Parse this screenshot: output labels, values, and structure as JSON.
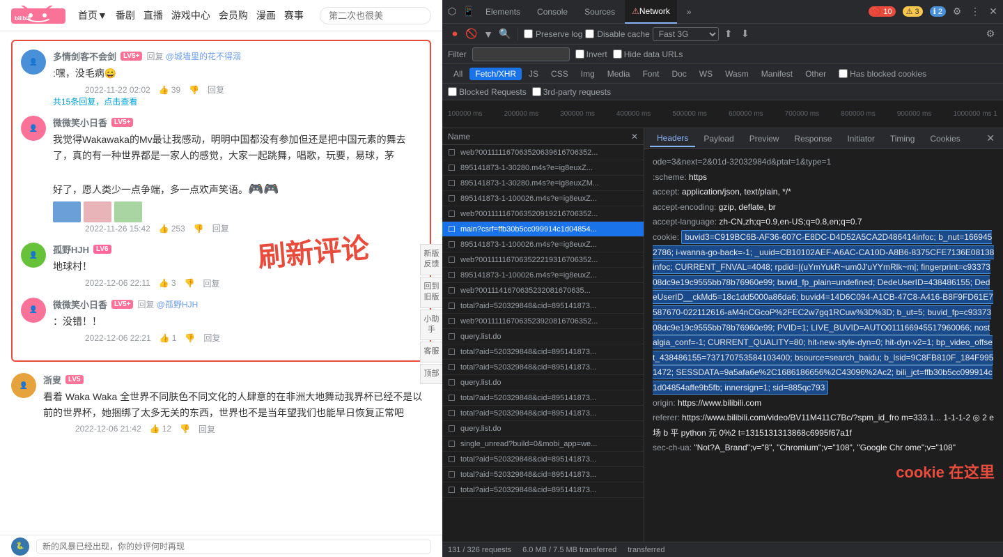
{
  "bilibili": {
    "logo_text": "哔哩哔哩",
    "nav_items": [
      "首页▼",
      "番剧",
      "直播",
      "游戏中心",
      "会员购",
      "漫画",
      "赛事"
    ],
    "search_placeholder": "第二次也很美",
    "comments": [
      {
        "id": 1,
        "username": "多情剑客不会剑",
        "level": "LV5+",
        "level_class": "lv5",
        "reply_to": "@城墙里的花不得溺",
        "text": ":嘿，没毛病",
        "emoji": "😄",
        "date": "2022-11-22 02:02",
        "likes": "39",
        "sub_comments_count": "共15条回复，点击查看"
      },
      {
        "id": 2,
        "username": "微微笑小日香",
        "level": "LV5+",
        "level_class": "lv5",
        "text": "我觉得Wakawaka的Mv最让我感动，明明中国都没有参加但还是把中国元素的舞去了，真的有一种世界都是一家人的感觉，大家一起跳舞，唱歌，玩要，易球，\n\n好了，愿人类少一点争端，多一点欢声笑语。",
        "date": "2022-11-26 15:42",
        "likes": "253",
        "has_images": true
      },
      {
        "id": 3,
        "username": "孤野HJH",
        "level": "LV6",
        "level_class": "lv6",
        "text": "地球村！",
        "date": "2022-12-06 22:11",
        "likes": "3"
      },
      {
        "id": 4,
        "username": "微微笑小日香",
        "level": "LV5+",
        "level_class": "lv5",
        "reply_to": "@孤野HJH",
        "text": "：没错！！",
        "date": "2022-12-06 22:21",
        "likes": "1"
      }
    ],
    "long_comment": {
      "username": "浙叟",
      "level": "LV5",
      "level_class": "lv5",
      "text": "看着 Waka Waka 全世界不同肤色不同文化的人肆意的在非洲大地舞动我界杯已经不是以前的世界杯，她捆绑了太多无关的东西，世界也不是当年望我们也能早日恢复正常吧",
      "date": "2022-12-06 21:42",
      "likes": "12"
    },
    "refresh_label": "刷新评论",
    "side_buttons": [
      "新版\n反馈",
      "回到\n旧版",
      "小助\n手",
      "客服"
    ],
    "bottom_placeholder": "新的风暴已经出现，你的妙评何时再现",
    "top_btn": "顶部"
  },
  "devtools": {
    "tabs": [
      "Elements",
      "Console",
      "Sources",
      "Network",
      "»"
    ],
    "active_tab": "Network",
    "error_count": "10",
    "warning_count": "3",
    "info_count": "2",
    "toolbar": {
      "record_tooltip": "Record network log",
      "clear_tooltip": "Clear",
      "filter_tooltip": "Filter",
      "search_tooltip": "Search",
      "preserve_log": "Preserve log",
      "disable_cache": "Disable cache",
      "throttle": "Fast 3G"
    },
    "filter": {
      "label": "Filter",
      "invert": "Invert",
      "hide_data_urls": "Hide data URLs"
    },
    "type_tabs": [
      "All",
      "Fetch/XHR",
      "JS",
      "CSS",
      "Img",
      "Media",
      "Font",
      "Doc",
      "WS",
      "Wasm",
      "Manifest",
      "Other"
    ],
    "active_type_tab": "Fetch/XHR",
    "has_blocked_cookies": "Has blocked cookies",
    "request_options": [
      "Blocked Requests",
      "3rd-party requests"
    ],
    "timeline_labels": [
      "100000 ms",
      "200000 ms",
      "300000 ms",
      "400000 ms",
      "500000 ms",
      "600000 ms",
      "700000 ms",
      "800000 ms",
      "900000 ms",
      "1000000 ms 1"
    ],
    "network_requests": [
      {
        "name": "web?001111167063520639616706352..."
      },
      {
        "name": "895141873-1-30280.m4s?e=ig8euxZ..."
      },
      {
        "name": "895141873-1-30280.m4s?e=ig8euxZM..."
      },
      {
        "name": "895141873-1-100026.m4s?e=ig8euxZ..."
      },
      {
        "name": "web?001111167063520919216706352..."
      },
      {
        "name": "main?csrf=ffb30b5cc099914c1d04854...",
        "selected": true
      },
      {
        "name": "895141873-1-100026.m4s?e=ig8euxZ..."
      },
      {
        "name": "web?001111167063522219316706352..."
      },
      {
        "name": "895141873-1-100026.m4s?e=ig8euxZ..."
      },
      {
        "name": "web?0011141670635232081670635..."
      },
      {
        "name": "total?aid=520329848&cid=895141873..."
      },
      {
        "name": "web?001111167063523920816706352..."
      },
      {
        "name": "query.list.do"
      },
      {
        "name": "total?aid=520329848&cid=895141873..."
      },
      {
        "name": "total?aid=520329848&cid=895141873..."
      },
      {
        "name": "query.list.do"
      },
      {
        "name": "total?aid=520329848&cid=895141873..."
      },
      {
        "name": "total?aid=520329848&cid=895141873..."
      },
      {
        "name": "query.list.do"
      },
      {
        "name": "single_unread?build=0&mobi_app=we..."
      },
      {
        "name": "total?aid=520329848&cid=895141873..."
      },
      {
        "name": "total?aid=520329848&cid=895141873..."
      },
      {
        "name": "total?aid=520329848&cid=895141873..."
      }
    ],
    "headers_panel": {
      "tabs": [
        "Headers",
        "Payload",
        "Preview",
        "Response",
        "Initiator",
        "Timing",
        "Cookies"
      ],
      "active_tab": "Headers",
      "request_url_partial": "ode=3&next=2&01d-32032984d&ptat=1&type=1",
      "headers": [
        {
          "key": ":scheme:",
          "value": "https"
        },
        {
          "key": "accept:",
          "value": "application/json, text/plain, */*"
        },
        {
          "key": "accept-encoding:",
          "value": "gzip, deflate, br"
        },
        {
          "key": "accept-language:",
          "value": "zh-CN,zh;q=0.9,en-US;q=0.8,en;q=0.7"
        },
        {
          "key": "cookie:",
          "value": "buvid3=C919BC6B-AF36-607C-E8DC-D4D52A5CA2D486414infoc; b_nut=1669452786; i-wanna-go-back=-1; _uuid=CB10102AEF-A6AC-CA10D-A8B6-8375CFE7136E08138infoc; CURRENT_FNVAL=4048; rpdid=|(uYmYukR~um0J'uYYmRlk~m|; fingerprint=c9337308dc9e19c9555bb78b76960e99; buvid_fp_plain=undefined; DedeUserID=438486155; DedeUserID__ckMd5=18c1dd5000a86da6; buvid4=14D6C094-A1CB-47C8-A416-B8F9FD61E7587670-022112616-aM4nCGcoP%2FEC2w7gq1RCuw%3D%3D; b_ut=5; buvid_fp=c9337308dc9e19c9555bb78b76960e99; PVID=1; LIVE_BUVID=AUTO011166945517960066; nostalgia_conf=-1; CURRENT_QUALITY=80; hit-new-style-dyn=0; hit-dyn-v2=1; bp_video_offset_438486155=737170753584103400; bsource=search_baidu; b_lsid=9C8FB810F_184F9951472; SESSDATA=9a5afa6e%2C1686186656%2C43096%2Ac2; bili_jct=ffb30b5cc099914c1d04854affe9b5fb; innersign=1; sid=885qc793",
          "is_cookie": true
        },
        {
          "key": "origin:",
          "value": "https://www.bilibili.com"
        },
        {
          "key": "referer:",
          "value": "https://www.bilibili.com/video/BV11M411C7Bc/?spm_id_from=333.1... 1-1-1-2 ◎ 2 e 场 b 平 python 元 0%2 t=1315131313868c6995f67a1f"
        },
        {
          "key": "sec-ch-ua:",
          "value": "\"Not?A_Brand\";v=\"8\", \"Chromium\";v=\"108\", \"Google Chrome\";v=\"108\""
        }
      ],
      "cookie_label": "cookie 在这里"
    },
    "status_bar": {
      "requests": "131 / 326 requests",
      "size": "6.0 MB / 7.5 MB transferred"
    }
  }
}
